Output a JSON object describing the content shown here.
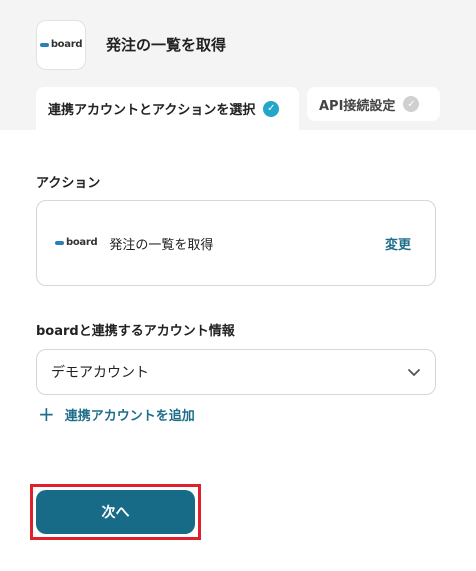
{
  "header": {
    "app_logo": "board",
    "title": "発注の一覧を取得"
  },
  "tabs": [
    {
      "label": "連携アカウントとアクションを選択",
      "active": true,
      "completed": true
    },
    {
      "label": "API接続設定",
      "active": false,
      "completed": false
    }
  ],
  "action": {
    "section_label": "アクション",
    "logo": "board",
    "name": "発注の一覧を取得",
    "change_label": "変更"
  },
  "account": {
    "section_label": "boardと連携するアカウント情報",
    "selected": "デモアカウント",
    "add_label": "連携アカウントを追加"
  },
  "footer": {
    "next_label": "次へ"
  },
  "colors": {
    "accent": "#176b86",
    "link": "#1f6f8b",
    "check": "#23a6c9",
    "highlight": "#e0202a"
  }
}
